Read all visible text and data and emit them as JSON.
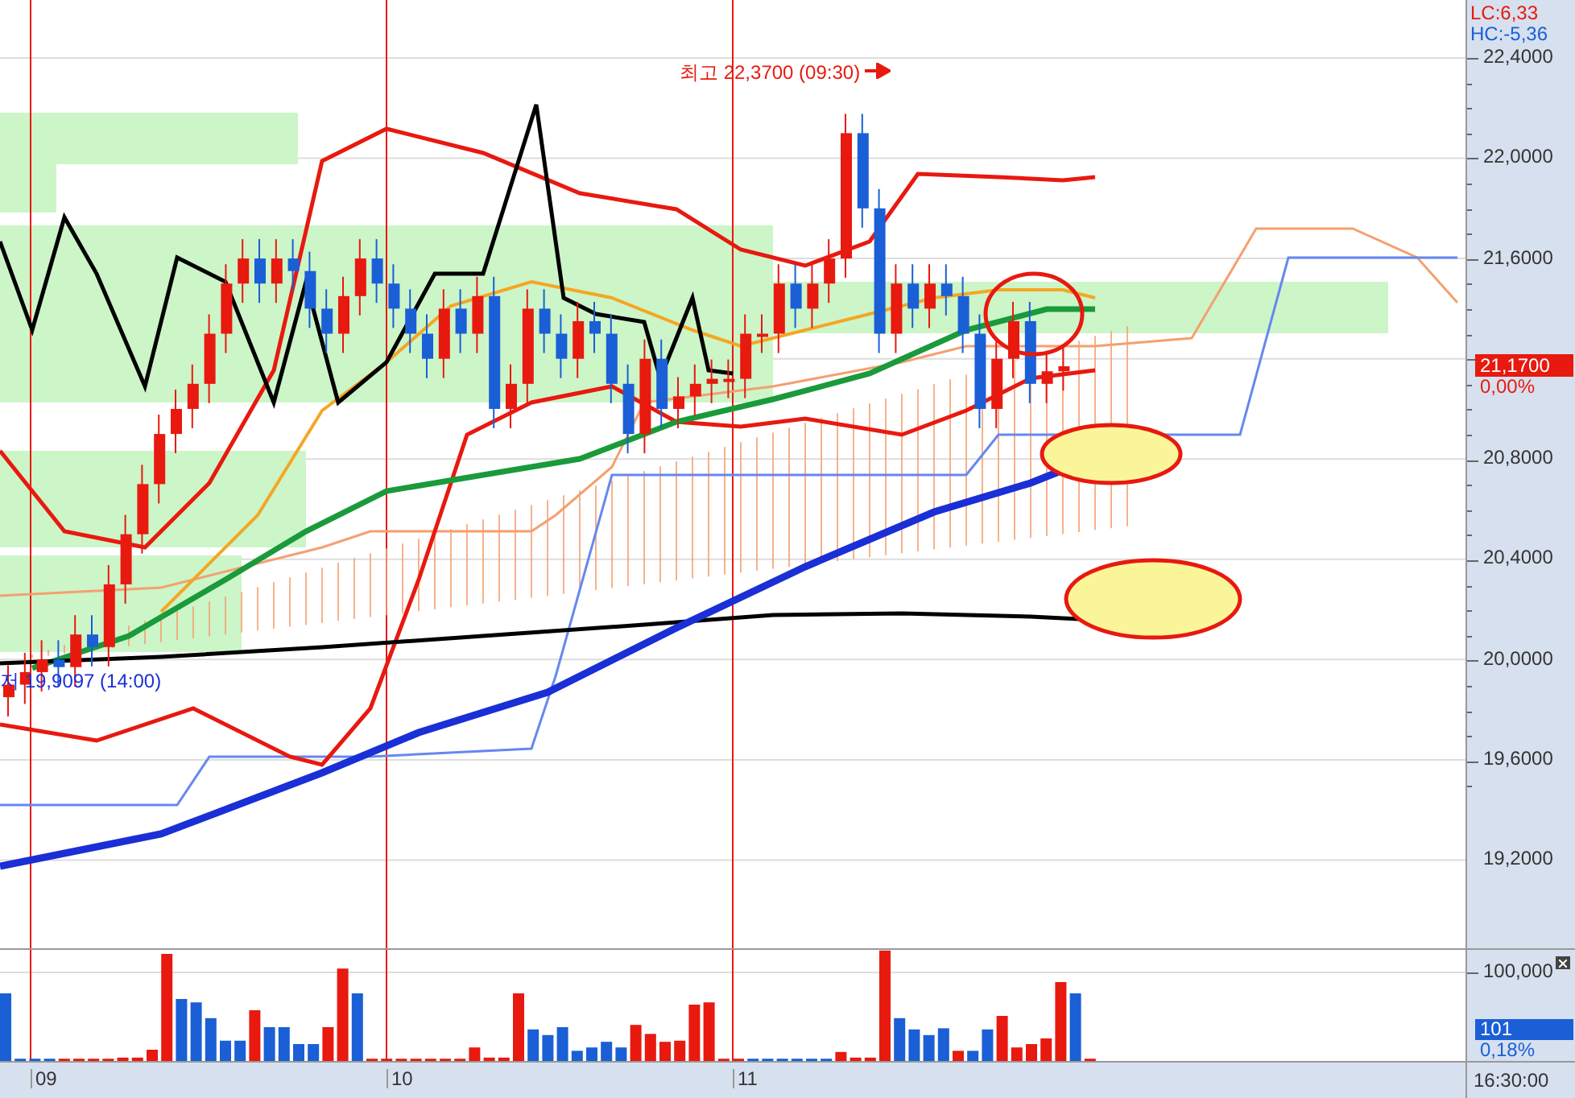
{
  "annotations": {
    "high": "최고 22,3700 (09:30)",
    "low": "저 19,9097 (14:00)"
  },
  "price_axis": {
    "lc": "LC:6,33",
    "hc": "HC:-5,36",
    "ticks": [
      "22,4000",
      "22,0000",
      "21,6000",
      "20,8000",
      "20,4000",
      "20,0000",
      "19,6000",
      "19,2000"
    ],
    "current_price": "21,1700",
    "change": "0,00%"
  },
  "volume_axis": {
    "tick": "100,000",
    "current_volume": "101",
    "change": "0,18%"
  },
  "time_axis": {
    "dates": [
      "09",
      "10",
      "11"
    ],
    "time": "16:30:00"
  }
}
